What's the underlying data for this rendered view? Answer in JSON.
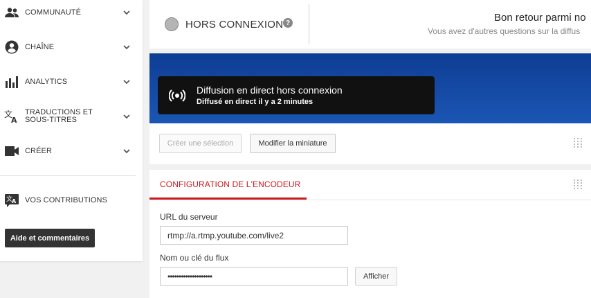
{
  "sidebar": {
    "items": [
      {
        "label": "COMMUNAUTÉ",
        "icon": "community-icon"
      },
      {
        "label": "CHAÎNE",
        "icon": "channel-icon"
      },
      {
        "label": "ANALYTICS",
        "icon": "analytics-icon"
      },
      {
        "label": "TRADUCTIONS ET SOUS-TITRES",
        "icon": "translate-icon"
      },
      {
        "label": "CRÉER",
        "icon": "video-camera-icon"
      }
    ],
    "contributions_label": "VOS CONTRIBUTIONS",
    "help_button": "Aide et commentaires"
  },
  "status": {
    "label": "HORS CONNEXION",
    "help_glyph": "?",
    "welcome_title": "Bon retour parmi no",
    "welcome_sub": "Vous avez d'autres questions sur la diffus"
  },
  "player": {
    "live_title": "Diffusion en direct hors connexion",
    "live_sub": "Diffusé en direct il y a 2 minutes",
    "btn_select": "Créer une sélection",
    "btn_thumbnail": "Modifier la miniature"
  },
  "encoder": {
    "tab": "CONFIGURATION DE L'ENCODEUR",
    "server_label": "URL du serveur",
    "server_value": "rtmp://a.rtmp.youtube.com/live2",
    "key_label": "Nom ou clé du flux",
    "key_value": "••••••••••••••••••••",
    "show_button": "Afficher"
  },
  "colors": {
    "accent_red": "#cc181e",
    "banner_blue": "#1b56b4",
    "dark": "#333333"
  }
}
